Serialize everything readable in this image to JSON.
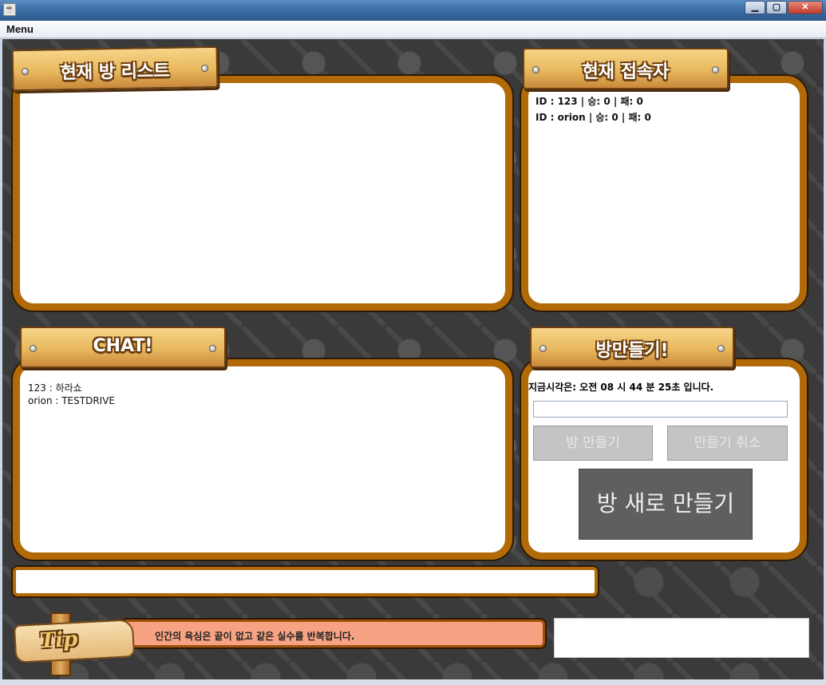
{
  "window": {
    "title": "",
    "buttons": {
      "minimize": "▁",
      "maximize": "▢",
      "close": "✕"
    }
  },
  "menubar": {
    "menu_label": "Menu"
  },
  "room_list": {
    "title": "현재 방 리스트",
    "rooms": []
  },
  "users": {
    "title": "현재 접속자",
    "items": [
      "ID : 123 | 승: 0 | 패: 0",
      "ID : orion | 승: 0 | 패: 0"
    ]
  },
  "chat": {
    "title": "CHAT!",
    "messages": [
      "123 : 하라쇼",
      "orion : TESTDRIVE"
    ],
    "input_value": ""
  },
  "make_room": {
    "title": "방만들기!",
    "clock": "지금시각은: 오전 08 시 44 분 25초 입니다.",
    "room_name_value": "",
    "create_label": "방 만들기",
    "cancel_label": "만들기 취소",
    "new_room_label": "방 새로 만들기"
  },
  "tip": {
    "label": "Tip",
    "text": "인간의 욕심은 끝이 없고 같은 실수를 반복합니다."
  },
  "colors": {
    "frame": "#b26a08",
    "background": "#3a3a3a",
    "tip_bar": "#f7a383",
    "new_room_button": "#5f5f5f"
  }
}
